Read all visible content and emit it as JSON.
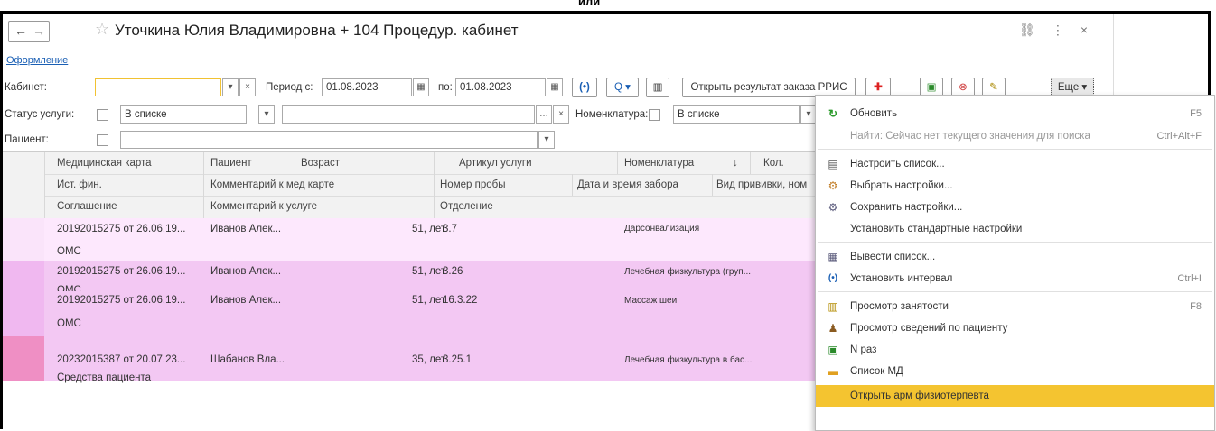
{
  "top_cut_text": "или",
  "window": {
    "title": "Уточкина Юлия Владимировна + 104 Процедур. кабинет",
    "back_glyph": "←",
    "forward_glyph": "→",
    "link_label": "Оформление"
  },
  "filters": {
    "kabinet_label": "Кабинет:",
    "kabinet_value": "",
    "period_from_label": "Период с:",
    "period_from": "01.08.2023",
    "period_to_label": "по:",
    "period_to": "01.08.2023",
    "interval_btn": "(•)",
    "search_btn": "Q ▾",
    "open_result_btn": "Открыть результат заказа РРИС",
    "more_btn": "Еще ▾",
    "status_label": "Статус услуги:",
    "status_mode": "В списке",
    "nomen_label": "Номенклатура:",
    "nomen_mode": "В списке",
    "patient_label": "Пациент:"
  },
  "grid": {
    "header_row1": [
      "Медицинская карта",
      "Пациент",
      "Возраст",
      "Артикул услуги",
      "Номенклатура",
      "↓",
      "Кол."
    ],
    "header_row2": [
      "Ист. фин.",
      "Комментарий к мед карте",
      "Номер пробы",
      "Дата и время забора",
      "Вид прививки, ном"
    ],
    "header_row3": [
      "Соглашение",
      "Комментарий к услуге",
      "Отделение"
    ],
    "rows": [
      {
        "card": "20192015275 от 26.06.19...",
        "patient": "Иванов Алек...",
        "age": "51, лет",
        "article": "3.7",
        "nomen": "Дарсонвализация",
        "fin": "ОМС"
      },
      {
        "card": "20192015275 от 26.06.19...",
        "patient": "Иванов Алек...",
        "age": "51, лет",
        "article": "3.26",
        "nomen": "Лечебная физкультура (груп...",
        "fin": "ОМС"
      },
      {
        "card": "20192015275 от 26.06.19...",
        "patient": "Иванов Алек...",
        "age": "51, лет",
        "article": "16.3.22",
        "nomen": "Массаж шеи",
        "fin": "ОМС"
      },
      {
        "card": "20232015387 от 20.07.23...",
        "patient": "Шабанов Вла...",
        "age": "35, лет",
        "article": "3.25.1",
        "nomen": "Лечебная физкультура в бас...",
        "fin": "Средства пациента"
      }
    ]
  },
  "menu": {
    "items": [
      {
        "label": "Обновить",
        "shortcut": "F5",
        "icon": "refresh-icon"
      },
      {
        "label": "Найти: Сейчас нет текущего значения для поиска",
        "shortcut": "Ctrl+Alt+F",
        "icon": ""
      },
      {
        "label": "Настроить список...",
        "shortcut": "",
        "icon": "list-settings-icon"
      },
      {
        "label": "Выбрать настройки...",
        "shortcut": "",
        "icon": "load-settings-icon"
      },
      {
        "label": "Сохранить настройки...",
        "shortcut": "",
        "icon": "save-settings-icon"
      },
      {
        "label": "Установить стандартные настройки",
        "shortcut": "",
        "icon": ""
      },
      {
        "label": "Вывести список...",
        "shortcut": "",
        "icon": "output-list-icon"
      },
      {
        "label": "Установить интервал",
        "shortcut": "Ctrl+I",
        "icon": "interval-icon"
      },
      {
        "label": "Просмотр занятости",
        "shortcut": "F8",
        "icon": "schedule-icon"
      },
      {
        "label": "Просмотр сведений по пациенту",
        "shortcut": "",
        "icon": "patient-icon"
      },
      {
        "label": "N раз",
        "shortcut": "",
        "icon": "repeat-icon"
      },
      {
        "label": "Список МД",
        "shortcut": "",
        "icon": "folder-icon"
      },
      {
        "label": "Открыть арм физиотерпевта",
        "shortcut": "",
        "icon": ""
      }
    ]
  }
}
